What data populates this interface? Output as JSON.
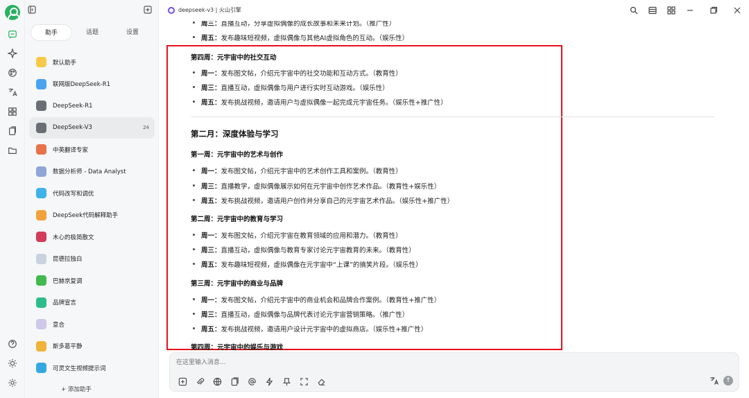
{
  "app": {
    "window_title": "deepseek-v3 | 火山引擎"
  },
  "sidebar": {
    "tabs": [
      "助手",
      "话题",
      "设置"
    ],
    "items": [
      {
        "label": "默认助手",
        "color": "#f7c948"
      },
      {
        "label": "联网版DeepSeek-R1",
        "color": "#4aa3f0"
      },
      {
        "label": "DeepSeek-R1",
        "color": "#6b6f75"
      },
      {
        "label": "DeepSeek-V3",
        "color": "#6b6f75",
        "badge": "24"
      },
      {
        "label": "中英翻译专家",
        "color": "#e8734a"
      },
      {
        "label": "数据分析师 - Data Analyst",
        "color": "#8fa6d8"
      },
      {
        "label": "代码改写和调优",
        "color": "#3fb3e8"
      },
      {
        "label": "DeepSeek代码解释助手",
        "color": "#f2a23c"
      },
      {
        "label": "木心的极简散文",
        "color": "#d23c5a"
      },
      {
        "label": "昆德拉独白",
        "color": "#c9d3e0"
      },
      {
        "label": "巴赫京复调",
        "color": "#41b94f"
      },
      {
        "label": "品牌宣言",
        "color": "#2ebd8a"
      },
      {
        "label": "意合",
        "color": "#cfc8ea"
      },
      {
        "label": "斯多葛平静",
        "color": "#f0b33a"
      },
      {
        "label": "可灵文生视频提示词",
        "color": "#35a9df"
      }
    ],
    "add_label": "+ 添加助手"
  },
  "content": {
    "top_lines": [
      {
        "day": "周三：",
        "text": "直播互动，分享虚拟偶像的成长故事和未来计划。（推广性）"
      },
      {
        "day": "周五：",
        "text": "发布趣味短视频，虚拟偶像与其他AI虚拟角色的互动。（娱乐性）"
      }
    ],
    "week4_title": "第四周：元宇宙中的社交互动",
    "week4_items": [
      {
        "day": "周一：",
        "text": "发布图文帖，介绍元宇宙中的社交功能和互动方式。（教育性）"
      },
      {
        "day": "周三：",
        "text": "直播互动，虚拟偶像与用户进行实时互动游戏。（娱乐性）"
      },
      {
        "day": "周五：",
        "text": "发布挑战视频，邀请用户与虚拟偶像一起完成元宇宙任务。（娱乐性+推广性）"
      }
    ],
    "month2_title": "第二月：深度体验与学习",
    "m2w1_title": "第一周：元宇宙中的艺术与创作",
    "m2w1_items": [
      {
        "day": "周一：",
        "text": "发布图文帖，介绍元宇宙中的艺术创作工具和案例。（教育性）"
      },
      {
        "day": "周三：",
        "text": "直播教学，虚拟偶像展示如何在元宇宙中创作艺术作品。（教育性+娱乐性）"
      },
      {
        "day": "周五：",
        "text": "发布挑战视频，邀请用户创作并分享自己的元宇宙艺术作品。（娱乐性+推广性）"
      }
    ],
    "m2w2_title": "第二周：元宇宙中的教育与学习",
    "m2w2_items": [
      {
        "day": "周一：",
        "text": "发布图文帖，介绍元宇宙在教育领域的应用和潜力。（教育性）"
      },
      {
        "day": "周三：",
        "text": "直播互动，虚拟偶像与教育专家讨论元宇宙教育的未来。（教育性）"
      },
      {
        "day": "周五：",
        "text": "发布趣味短视频，虚拟偶像在元宇宙中“上课”的搞笑片段。（娱乐性）"
      }
    ],
    "m2w3_title": "第三周：元宇宙中的商业与品牌",
    "m2w3_items": [
      {
        "day": "周一：",
        "text": "发布图文帖，介绍元宇宙中的商业机会和品牌合作案例。（教育性+推广性）"
      },
      {
        "day": "周三：",
        "text": "直播互动，虚拟偶像与品牌代表讨论元宇宙营销策略。（推广性）"
      },
      {
        "day": "周五：",
        "text": "发布挑战视频，邀请用户设计元宇宙中的虚拟商店。（娱乐性+推广性）"
      }
    ],
    "m2w4_title": "第四周：元宇宙中的娱乐与游戏"
  },
  "input": {
    "placeholder": "在这里输入消息..."
  },
  "colors": {
    "accent": "#27b25f",
    "highlight_box": "#e8101a"
  }
}
